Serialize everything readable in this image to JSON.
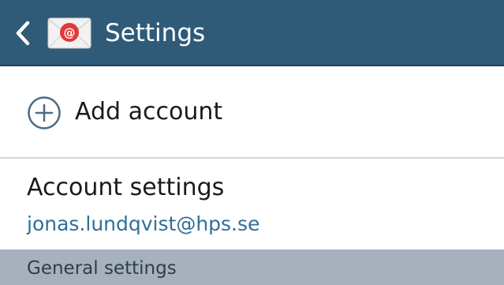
{
  "header": {
    "title": "Settings",
    "back_icon": "chevron-left-icon",
    "app_icon": "email-envelope-icon",
    "app_icon_glyph": "@",
    "background": "#2f5b78"
  },
  "add_account": {
    "icon": "plus-circle-icon",
    "label": "Add account"
  },
  "account_settings": {
    "title": "Account settings",
    "email": "jonas.lundqvist@hps.se",
    "email_color": "#2f6f98"
  },
  "section": {
    "label": "General settings",
    "background": "#a6b1bd"
  }
}
